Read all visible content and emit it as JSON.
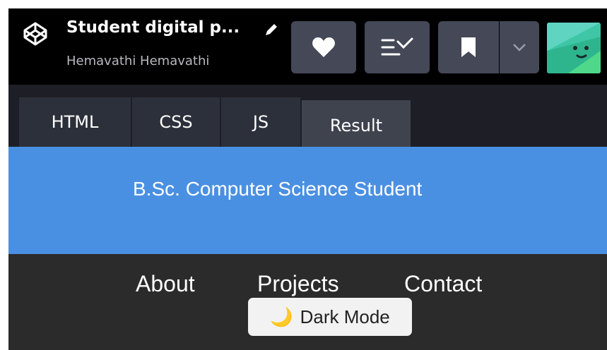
{
  "pen": {
    "title": "Student digital p...",
    "author": "Hemavathi Hemavathi"
  },
  "header_buttons": {
    "like": "heart-icon",
    "collections": "list-check-icon",
    "bookmark": "bookmark-icon",
    "bookmark_more": "chevron-down-icon"
  },
  "tabs": [
    {
      "label": "HTML"
    },
    {
      "label": "CSS"
    },
    {
      "label": "JS"
    },
    {
      "label": "Result",
      "active": true
    }
  ],
  "preview": {
    "banner_text": "B.Sc. Computer Science Student",
    "nav": [
      "About",
      "Projects",
      "Contact"
    ],
    "dark_mode_button": {
      "icon": "🌙",
      "label": "Dark Mode"
    }
  },
  "colors": {
    "banner": "#4a90e2",
    "header_bg": "#000000",
    "button_bg": "#444857",
    "active_tab": "#3f434e"
  }
}
